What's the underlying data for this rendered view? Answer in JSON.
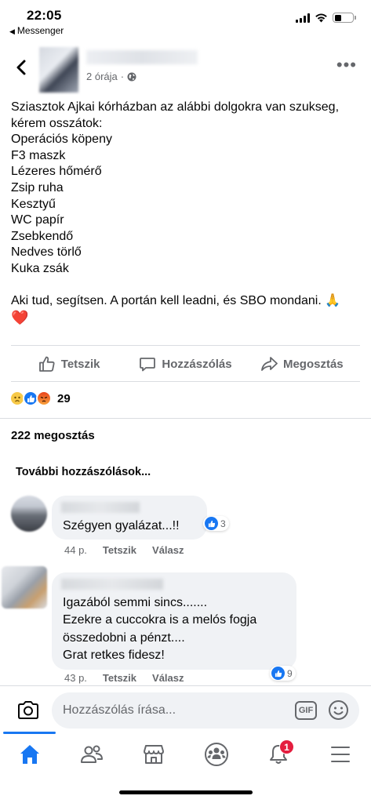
{
  "status_bar": {
    "time": "22:05",
    "back_app": "Messenger"
  },
  "post": {
    "time": "2 órája",
    "lines": [
      "Sziasztok  Ajkai kórházban az alábbi dolgokra van szukseg,",
      "kérem osszátok:",
      "Operációs köpeny",
      "F3 maszk",
      "Lézeres hőmérő",
      "Zsip ruha",
      "Kesztyű",
      "WC papír",
      "Zsebkendő",
      "Nedves törlő",
      "Kuka zsák"
    ],
    "closing": "Aki tud, segítsen. A portán kell leadni, és SBO mondani. 🙏",
    "heart": "❤️"
  },
  "actions": {
    "like": "Tetszik",
    "comment": "Hozzászólás",
    "share": "Megosztás"
  },
  "reactions": {
    "icons": [
      "sad-reaction",
      "like-reaction",
      "angry-reaction"
    ],
    "count": "29"
  },
  "shares_text": "222 megosztás",
  "more_comments": "További hozzászólások...",
  "comments": [
    {
      "text_lines": [
        "Szégyen gyalázat...!!"
      ],
      "time": "44 p.",
      "like_label": "Tetszik",
      "reply_label": "Válasz",
      "reaction_count": "3"
    },
    {
      "text_lines": [
        "Igazából semmi sincs.......",
        "Ezekre a cuccokra is a melós fogja",
        "összedobni a pénzt....",
        "Grat retkes fidesz!"
      ],
      "time": "43 p.",
      "like_label": "Tetszik",
      "reply_label": "Válasz",
      "reaction_count": "9"
    }
  ],
  "composer": {
    "placeholder": "Hozzászólás írása...",
    "gif_label": "GIF"
  },
  "tabbar": {
    "items": [
      "home-icon",
      "friends-icon",
      "marketplace-icon",
      "groups-icon",
      "notifications-icon",
      "menu-icon"
    ],
    "notification_badge": "1"
  },
  "colors": {
    "accent": "#1877f2",
    "text_secondary": "#65676b",
    "badge": "#e41e3f",
    "bubble": "#f0f2f5"
  }
}
